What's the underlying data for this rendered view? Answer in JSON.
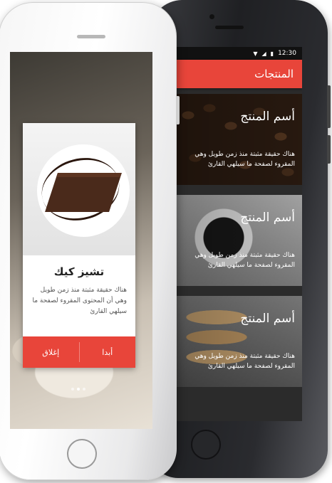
{
  "status_bar": {
    "time": "12:30"
  },
  "products_screen": {
    "title": "المنتجات",
    "products": [
      {
        "name": "أسم المنتج",
        "description": "هناك حقيقة مثبتة منذ زمن طويل وهي المقروء لصفحة ما سيلهي القارئ"
      },
      {
        "name": "أسم المنتج",
        "description": "هناك حقيقة مثبتة منذ زمن طويل وهي المقروء لصفحة ما سيلهي القارئ"
      },
      {
        "name": "أسم المنتج",
        "description": "هناك حقيقة مثبتة منذ زمن طويل وهي المقروء لصفحة ما سيلهي القارئ"
      }
    ]
  },
  "dialog": {
    "title": "تشيز كيك",
    "text": "هناك حقيقة مثبتة منذ زمن طويل وهي أن المحتوى المقروء لصفحة ما سيلهي القارئ",
    "start_label": "أبدا",
    "close_label": "إغلاق"
  },
  "colors": {
    "accent": "#e8453a"
  }
}
